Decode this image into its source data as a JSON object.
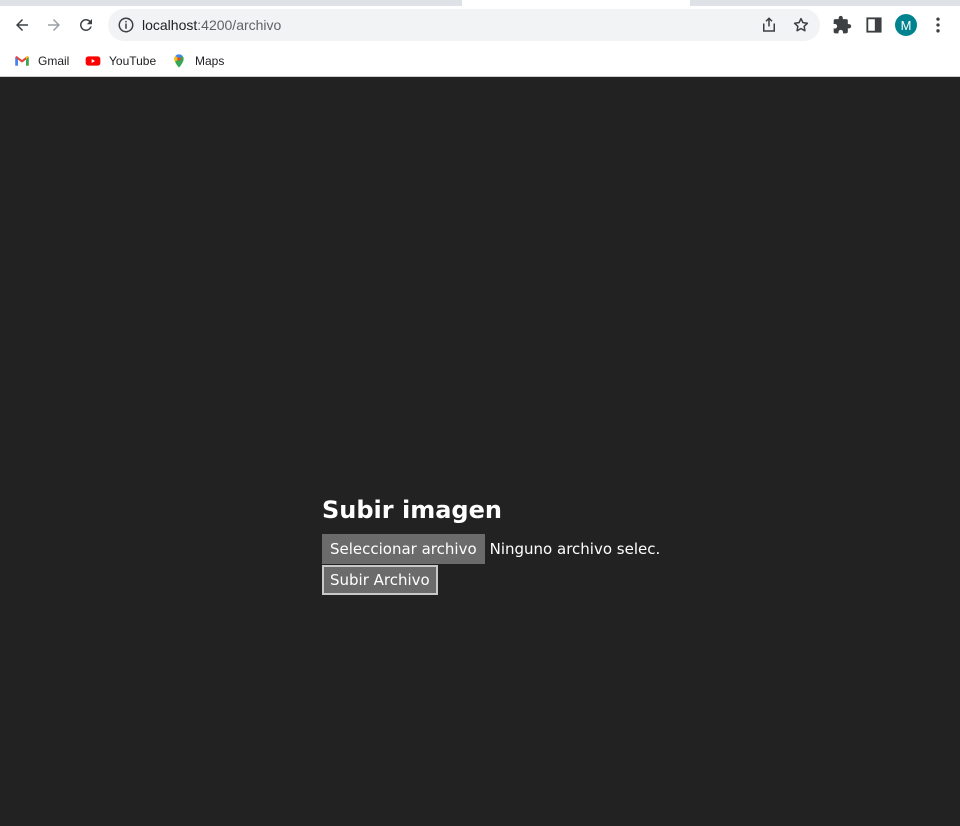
{
  "browser": {
    "url_host": "localhost",
    "url_path": ":4200/archivo",
    "avatar_letter": "M",
    "bookmarks": [
      {
        "label": "Gmail",
        "icon": "gmail-icon"
      },
      {
        "label": "YouTube",
        "icon": "youtube-icon"
      },
      {
        "label": "Maps",
        "icon": "maps-icon"
      }
    ]
  },
  "page": {
    "title": "Subir imagen",
    "file_button_label": "Seleccionar archivo",
    "file_status": "Ninguno archivo selec.",
    "submit_label": "Subir Archivo"
  },
  "colors": {
    "background": "#222222",
    "button": "#6b6b6b",
    "avatar": "#00838f"
  }
}
